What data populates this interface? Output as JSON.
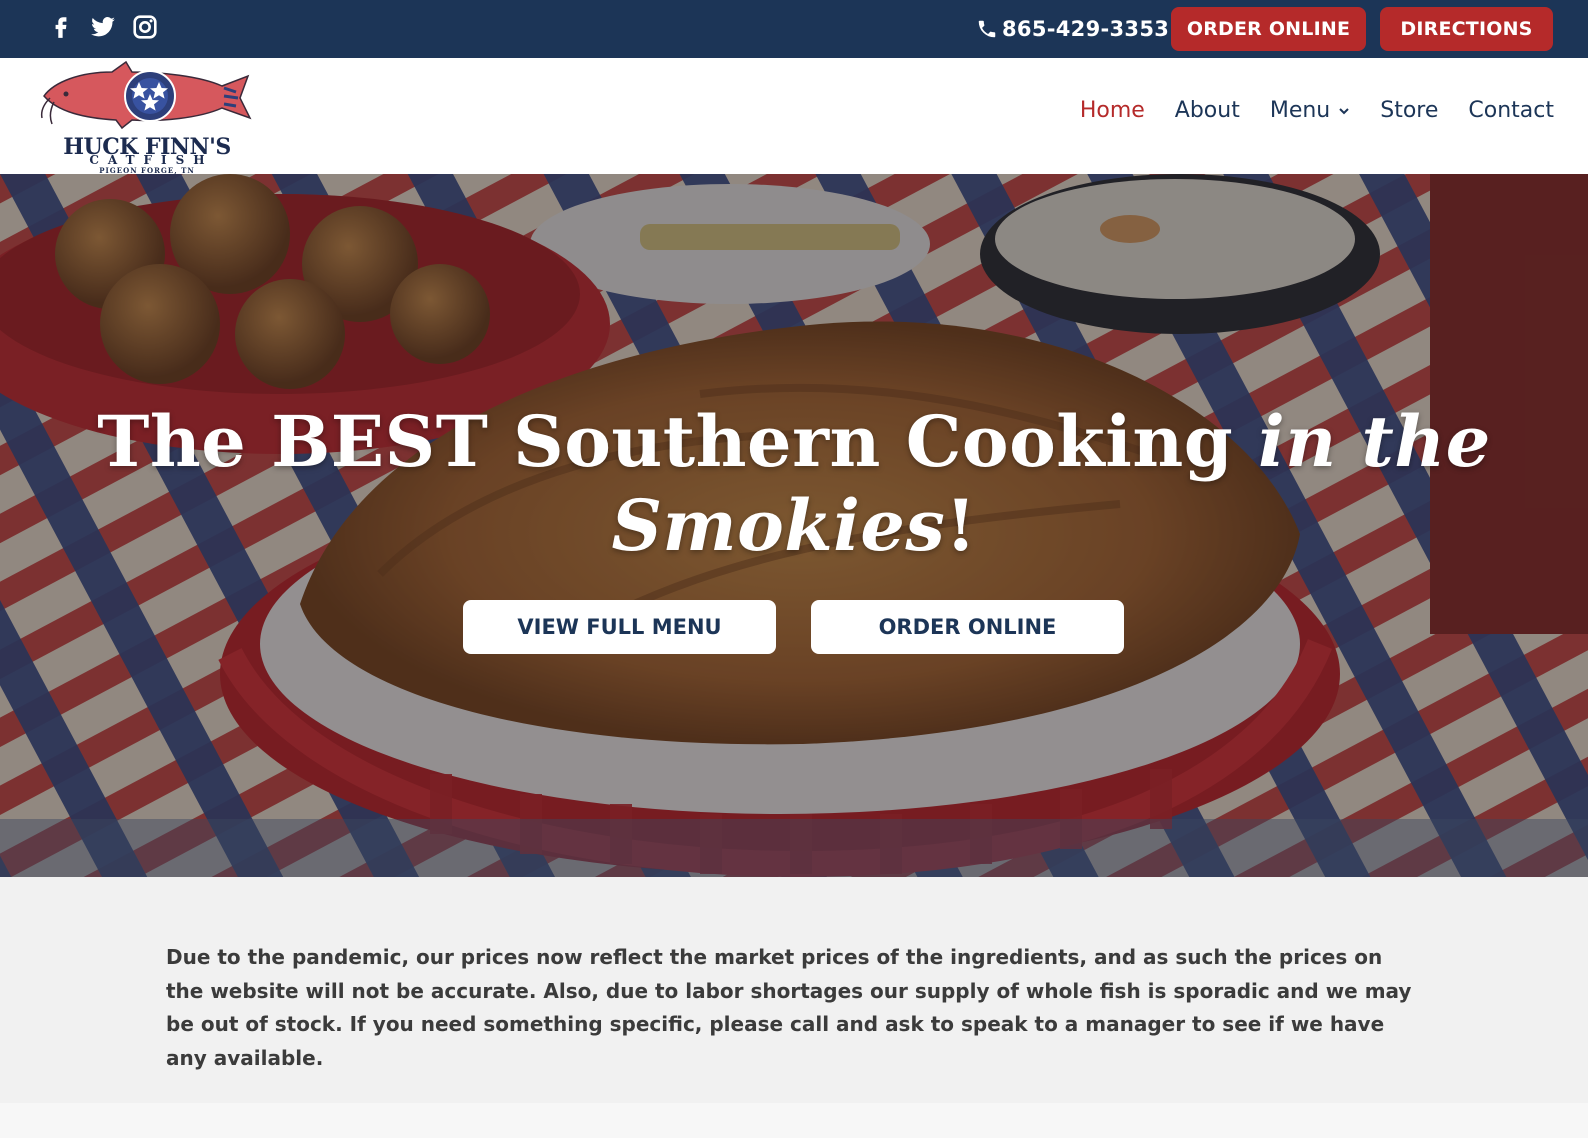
{
  "colors": {
    "topbar_bg": "#1c3557",
    "accent_red": "#b52a2a",
    "nav_text": "#1c3557",
    "notice_bg": "#f1f1f1"
  },
  "topbar": {
    "social_icons": [
      "facebook-icon",
      "twitter-icon",
      "instagram-icon"
    ],
    "phone": "865-429-3353",
    "order_online_label": "ORDER ONLINE",
    "directions_label": "DIRECTIONS"
  },
  "logo": {
    "name": "HUCK FINN'S",
    "subname": "CATFISH",
    "town": "PIGEON FORGE, TN"
  },
  "nav": {
    "items": [
      {
        "label": "Home",
        "active": true
      },
      {
        "label": "About"
      },
      {
        "label": "Menu",
        "has_dropdown": true
      },
      {
        "label": "Store"
      },
      {
        "label": "Contact"
      }
    ]
  },
  "hero": {
    "title_part1": "The BEST Southern Cooking ",
    "title_italic1": "in the",
    "title_italic2": "Smokies",
    "title_end": "!",
    "buttons": {
      "view_menu": "VIEW FULL MENU",
      "order_online": "ORDER ONLINE"
    }
  },
  "notice": {
    "text": "Due to the pandemic, our prices now reflect the market prices of the ingredients, and as such the prices on the website will not be accurate. Also, due to labor shortages our supply of whole fish is sporadic and we may be out of stock. If you need something specific, please call and ask to speak to a manager to see if we have any available."
  }
}
